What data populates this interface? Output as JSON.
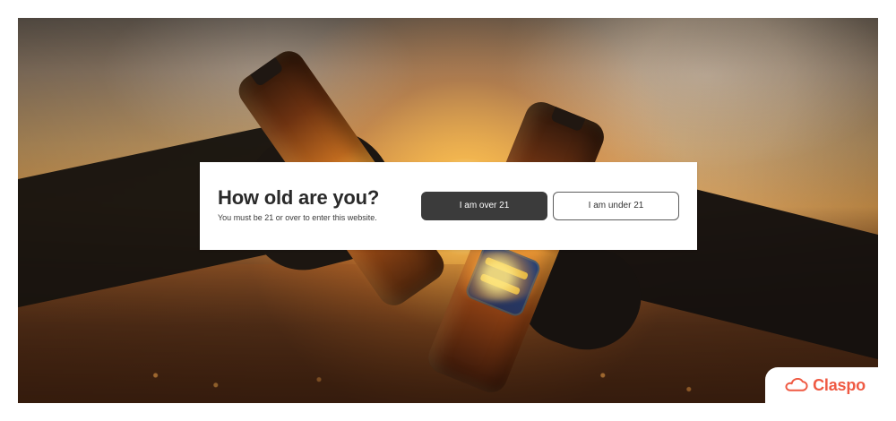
{
  "modal": {
    "title": "How old are you?",
    "subtitle": "You must be 21 or over to enter this website.",
    "buttons": {
      "over_label": "I am over 21",
      "under_label": "I am under 21"
    }
  },
  "brand": {
    "name": "Claspo",
    "icon": "cloud-icon",
    "accent_color": "#ef5a43"
  },
  "background": {
    "scene_icon": "beer-toast-sunset-image"
  }
}
